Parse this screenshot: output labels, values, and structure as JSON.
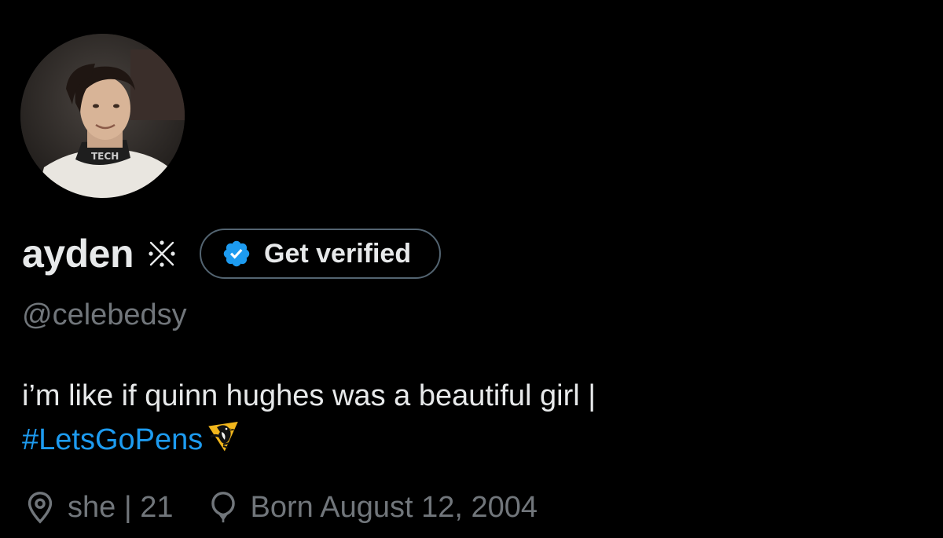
{
  "profile": {
    "display_name": "ayden",
    "name_symbol": "※",
    "verify_button": {
      "label": "Get verified",
      "icon": "verified-badge-icon",
      "badge_color": "#1d9bf0"
    },
    "handle": "@celebedsy",
    "bio": {
      "line1": "i’m like if quinn hughes was a beautiful girl |",
      "hashtag": "#LetsGoPens",
      "emoji": "penguin-logo-icon"
    },
    "meta": {
      "location": {
        "icon": "location-pin-icon",
        "text": "she | 21"
      },
      "birthday": {
        "icon": "balloon-icon",
        "text": "Born August 12, 2004"
      }
    }
  },
  "colors": {
    "background": "#000000",
    "primary_text": "#e7e9ea",
    "secondary_text": "#71767b",
    "accent": "#1d9bf0",
    "button_border": "#536471"
  }
}
